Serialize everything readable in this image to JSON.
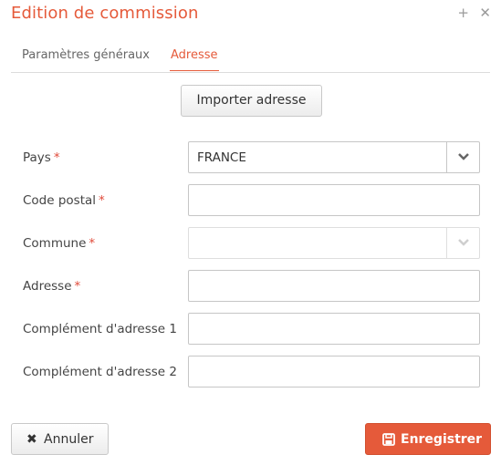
{
  "dialog": {
    "title": "Edition de commission",
    "plus_icon": "plus-icon",
    "close_icon": "close-icon"
  },
  "tabs": [
    {
      "label": "Paramètres généraux",
      "active": false
    },
    {
      "label": "Adresse",
      "active": true
    }
  ],
  "import_button": {
    "label": "Importer adresse"
  },
  "form": {
    "required_marker": "*",
    "pays": {
      "label": "Pays",
      "value": "FRANCE",
      "required": true
    },
    "code_postal": {
      "label": "Code postal",
      "value": "",
      "required": true
    },
    "commune": {
      "label": "Commune",
      "value": "",
      "required": true,
      "disabled": true
    },
    "adresse": {
      "label": "Adresse",
      "value": "",
      "required": true
    },
    "complement1": {
      "label": "Complément d'adresse 1",
      "value": ""
    },
    "complement2": {
      "label": "Complément d'adresse 2",
      "value": ""
    }
  },
  "footer": {
    "cancel": {
      "label": "Annuler",
      "icon": "times-icon"
    },
    "save": {
      "label": "Enregistrer",
      "icon": "save-icon"
    }
  },
  "colors": {
    "accent": "#e55a3a",
    "required": "#e04a3a"
  }
}
